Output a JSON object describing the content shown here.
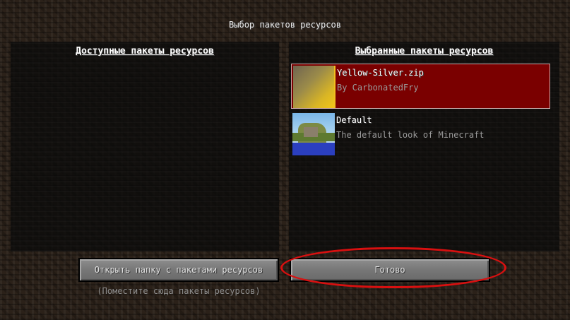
{
  "screen": {
    "title": "Выбор пакетов ресурсов"
  },
  "available_panel": {
    "header": "Доступные пакеты ресурсов",
    "items": []
  },
  "selected_panel": {
    "header": "Выбранные пакеты ресурсов",
    "items": [
      {
        "name": "Yellow-Silver.zip",
        "description": "By CarbonatedFry",
        "selected": true
      },
      {
        "name": "Default",
        "description": "The default look of Minecraft",
        "selected": false
      }
    ]
  },
  "buttons": {
    "open_folder": "Открыть папку с пакетами ресурсов",
    "done": "Готово"
  },
  "hint": "(Поместите сюда пакеты ресурсов)",
  "colors": {
    "selection": "#7a0000",
    "annotation": "#d81010"
  }
}
